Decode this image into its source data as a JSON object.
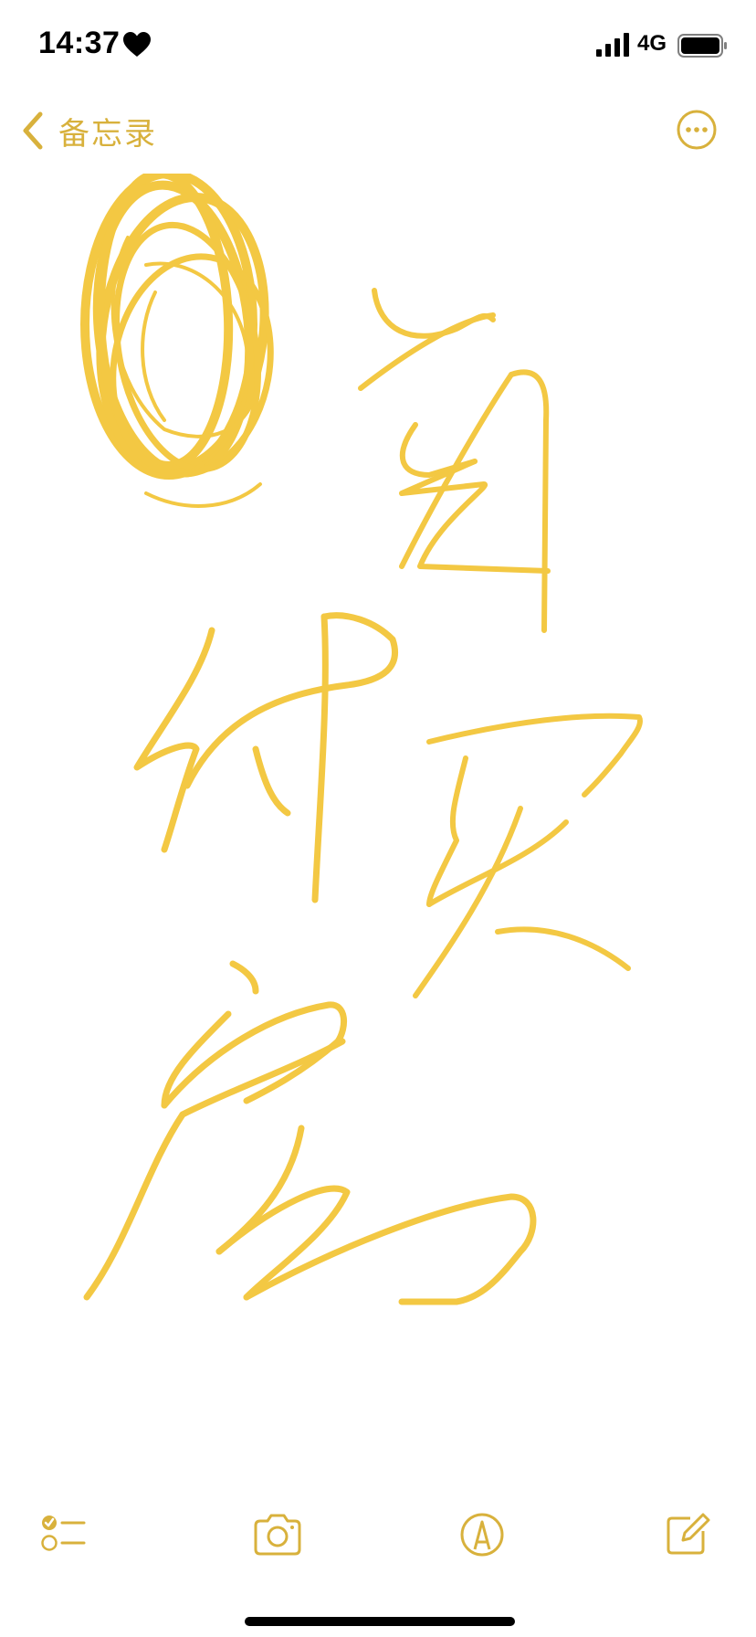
{
  "status_bar": {
    "time": "14:37",
    "network": "4G",
    "icons": [
      "heart-icon",
      "cellular-signal-icon",
      "battery-icon"
    ]
  },
  "nav": {
    "back_label": "备忘录",
    "icons": [
      "chevron-left-icon",
      "more-ellipsis-icon"
    ]
  },
  "toolbar": {
    "items": [
      {
        "name": "checklist",
        "icon": "checklist-icon"
      },
      {
        "name": "camera",
        "icon": "camera-icon"
      },
      {
        "name": "markup",
        "icon": "markup-pen-icon"
      },
      {
        "name": "compose",
        "icon": "compose-icon"
      }
    ]
  },
  "colors": {
    "accent": "#d8b13c",
    "ink": "#f3c843",
    "background": "#ffffff"
  }
}
